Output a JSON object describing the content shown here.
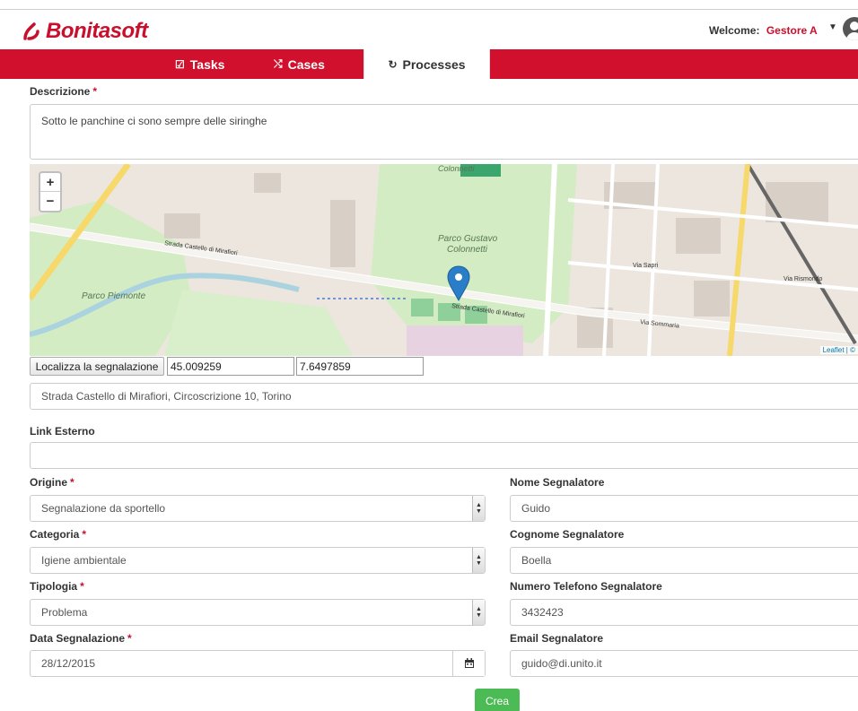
{
  "header": {
    "brand": "Bonitasoft",
    "welcome_label": "Welcome:",
    "user_name": "Gestore A"
  },
  "nav": {
    "tabs": [
      {
        "label": "Tasks",
        "icon": "checkbox-icon"
      },
      {
        "label": "Cases",
        "icon": "shuffle-icon"
      },
      {
        "label": "Processes",
        "icon": "processes-icon"
      }
    ],
    "active": "Processes"
  },
  "form": {
    "descrizione": {
      "label": "Descrizione",
      "value": "Sotto le panchine ci sono sempre delle siringhe"
    },
    "map": {
      "zoom_in": "+",
      "zoom_out": "−",
      "labels": {
        "park1": "Parco Gustavo",
        "park1b": "Colonnetti",
        "park2": "Parco Piemonte",
        "street": "Strada Castello di Mirafiori",
        "street2": "Strada Castello di Mirafiori",
        "top": "Colonnetti",
        "via1": "Via Sommaria",
        "via2": "Via Sapri",
        "via3": "Via Rismondo"
      },
      "attribution": "Leaflet | ©"
    },
    "localizza": {
      "button_label": "Localizza la segnalazione",
      "lat": "45.009259",
      "lng": "7.6497859"
    },
    "indirizzo": {
      "value": "Strada Castello di Mirafiori, Circoscrizione 10, Torino"
    },
    "link_esterno": {
      "label": "Link Esterno",
      "value": ""
    },
    "origine": {
      "label": "Origine",
      "value": "Segnalazione da sportello"
    },
    "categoria": {
      "label": "Categoria",
      "value": "Igiene ambientale"
    },
    "tipologia": {
      "label": "Tipologia",
      "value": "Problema"
    },
    "data_segnalazione": {
      "label": "Data Segnalazione",
      "value": "28/12/2015"
    },
    "nome": {
      "label": "Nome Segnalatore",
      "value": "Guido"
    },
    "cognome": {
      "label": "Cognome Segnalatore",
      "value": "Boella"
    },
    "telefono": {
      "label": "Numero Telefono Segnalatore",
      "value": "3432423"
    },
    "email": {
      "label": "Email Segnalatore",
      "value": "guido@di.unito.it"
    },
    "required_mark": "*",
    "submit_label": "Crea"
  },
  "colors": {
    "brand_red": "#d0102c",
    "submit_green": "#4cba55",
    "park_green": "#cfeac0",
    "marker_blue": "#2a7ec8"
  }
}
